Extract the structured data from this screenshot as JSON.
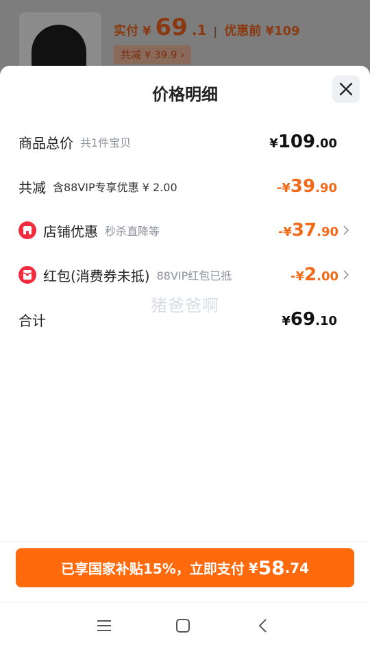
{
  "background": {
    "paid_label": "实付",
    "yen": "¥",
    "paid_int": "69",
    "paid_dec": ".1",
    "separator": "|",
    "before_label": "优惠前 ¥109",
    "save_tag": "共减 ¥ 39.9 ›"
  },
  "sheet": {
    "title": "价格明细",
    "close_icon": "close-icon"
  },
  "rows": {
    "total": {
      "label": "商品总价",
      "sub": "共1件宝贝",
      "yen": "¥",
      "int": "109",
      "dec": ".00"
    },
    "reduce": {
      "label": "共减",
      "sub": "含88VIP专享优惠 ¥ 2.00",
      "yen": "-¥",
      "int": "39",
      "dec": ".90"
    },
    "shop": {
      "label": "店铺优惠",
      "sub": "秒杀直降等",
      "yen": "-¥",
      "int": "37",
      "dec": ".90",
      "icon": "shop-icon"
    },
    "redpack": {
      "label": "红包(消费券未抵)",
      "sub": "88VIP红包已抵",
      "yen": "-¥",
      "int": "2",
      "dec": ".00",
      "icon": "red-envelope-icon"
    },
    "sum": {
      "label": "合计",
      "yen": "¥",
      "int": "69",
      "dec": ".10"
    }
  },
  "watermark": "猪爸爸啊",
  "pay_button": {
    "text": "已享国家补贴15%，立即支付",
    "yen": "¥",
    "int": "58",
    "dec": ".74"
  },
  "colors": {
    "accent_orange": "#ff6a0d",
    "discount_orange": "#f06a1a",
    "badge_red": "#f22c3f"
  },
  "navbar": [
    "menu-icon",
    "home-icon",
    "back-icon"
  ]
}
